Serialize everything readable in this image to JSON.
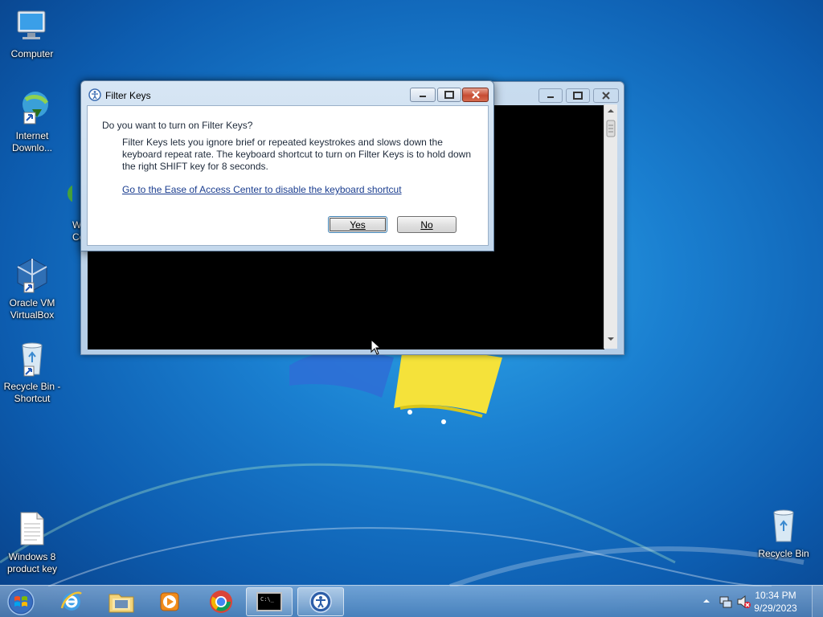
{
  "desktop": {
    "icons": [
      {
        "name": "desk-icon-computer",
        "label": "Computer"
      },
      {
        "name": "desk-icon-internet-download",
        "label": "Internet Downlo..."
      },
      {
        "name": "desk-icon-partial",
        "label": "W\nCo"
      },
      {
        "name": "desk-icon-virtualbox",
        "label": "Oracle VM VirtualBox"
      },
      {
        "name": "desk-icon-recycle-bin-shortcut",
        "label": "Recycle Bin - Shortcut"
      },
      {
        "name": "desk-icon-windows8-key",
        "label": "Windows 8 product key"
      },
      {
        "name": "desk-icon-recycle-bin",
        "label": "Recycle Bin"
      }
    ]
  },
  "dialog": {
    "title": "Filter Keys",
    "question": "Do you want to turn on Filter Keys?",
    "description": "Filter Keys lets you ignore brief or repeated keystrokes and slows down the keyboard repeat rate.  The keyboard shortcut to turn on Filter Keys is to hold down the right SHIFT key for 8 seconds.",
    "link": "Go to the Ease of Access Center to disable the keyboard shortcut",
    "yes_label": "Yes",
    "no_label": "No"
  },
  "taskbar": {
    "items": [
      "internet-explorer-icon",
      "windows-explorer-icon",
      "media-player-icon",
      "chrome-icon",
      "command-prompt-icon",
      "ease-of-access-icon"
    ],
    "active_items": [
      "command-prompt-icon",
      "ease-of-access-icon"
    ],
    "clock": {
      "time": "10:34 PM",
      "date": "9/29/2023"
    }
  },
  "colors": {
    "accent": "#1a7fd0",
    "console_bg": "#000000",
    "close_button": "#c74c33",
    "link": "#1a3d8f"
  }
}
